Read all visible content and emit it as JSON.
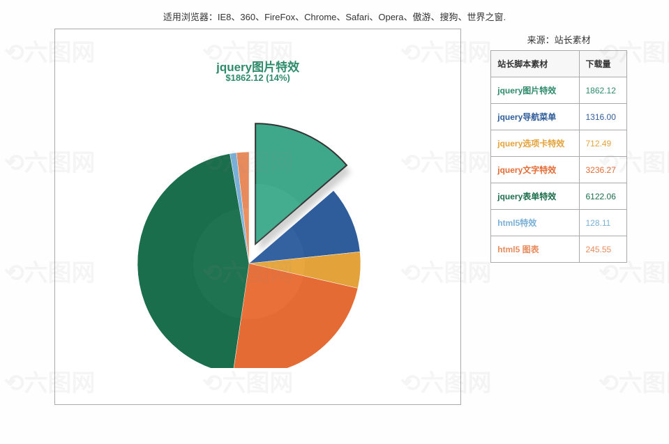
{
  "header": "适用浏览器：IE8、360、FireFox、Chrome、Safari、Opera、傲游、搜狗、世界之窗.",
  "sidebar": {
    "source_label": "来源：站长素材",
    "col1": "站长脚本素材",
    "col2": "下载量"
  },
  "chart_label": {
    "title": "jquery图片特效",
    "subtitle": "$1862.12 (14%)"
  },
  "chart_data": {
    "type": "pie",
    "title": "jquery图片特效",
    "highlighted_slice": {
      "name": "jquery图片特效",
      "value": 1862.12,
      "percent": 14,
      "formatted": "$1862.12 (14%)"
    },
    "series": [
      {
        "name": "jquery图片特效",
        "value": 1862.12,
        "color": "#3fa88a"
      },
      {
        "name": "jquery导航菜单",
        "value": 1316.0,
        "color": "#2f5d9b"
      },
      {
        "name": "jquery选项卡特效",
        "value": 712.49,
        "color": "#e3a33a"
      },
      {
        "name": "jquery文字特效",
        "value": 3236.27,
        "color": "#e46b34"
      },
      {
        "name": "jquery表单特效",
        "value": 6122.06,
        "color": "#1b6e4c"
      },
      {
        "name": "html5特效",
        "value": 128.11,
        "color": "#7ab0d8"
      },
      {
        "name": "html5 图表",
        "value": 245.55,
        "color": "#e88b5c"
      }
    ],
    "table_values": [
      "1862.12",
      "1316.00",
      "712.49",
      "3236.27",
      "6122.06",
      "128.11",
      "245.55"
    ]
  }
}
